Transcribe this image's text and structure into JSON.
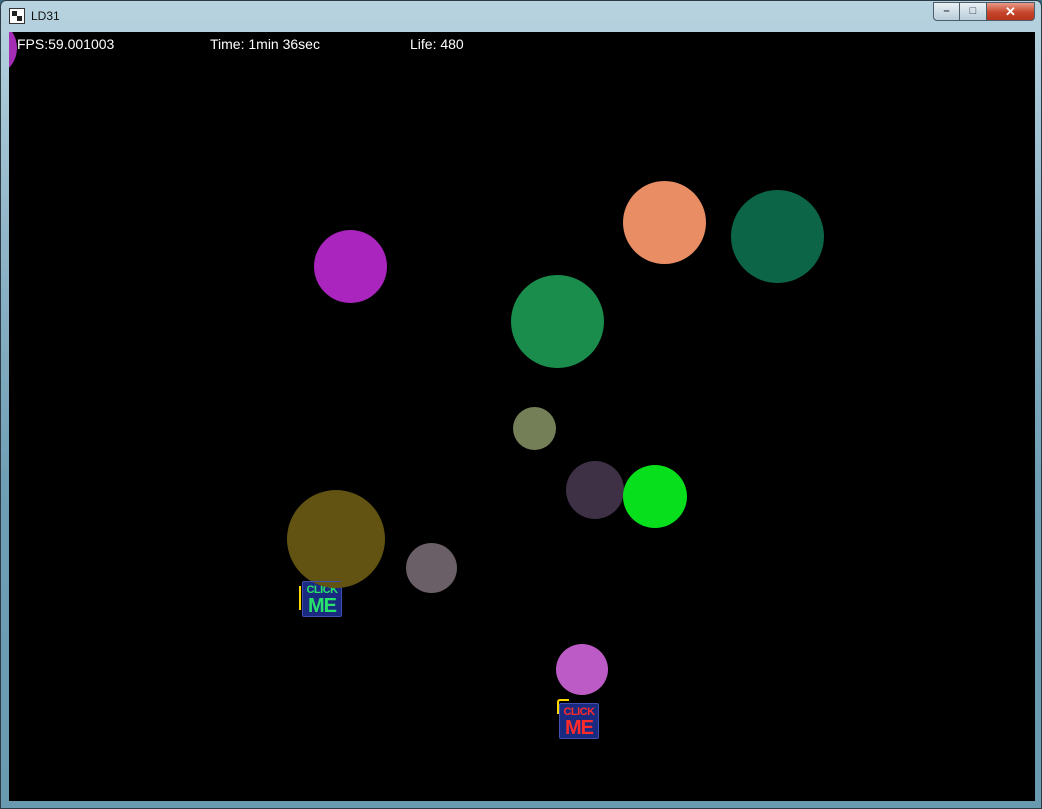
{
  "window": {
    "title": "LD31",
    "app_icon": "game-app-icon"
  },
  "controls": {
    "minimize": "–",
    "maximize": "□",
    "close": "✕"
  },
  "hud": {
    "fps": "FPS:59.001003",
    "time": "Time: 1min 36sec",
    "life": "Life: 480"
  },
  "balls": [
    {
      "name": "ball-magenta-edge",
      "color": "#a42db6"
    },
    {
      "name": "ball-purple",
      "color": "#a925bd"
    },
    {
      "name": "ball-salmon",
      "color": "#e98d64"
    },
    {
      "name": "ball-dark-green",
      "color": "#0c6547"
    },
    {
      "name": "ball-green",
      "color": "#1a8d4d"
    },
    {
      "name": "ball-olive-small",
      "color": "#747f57"
    },
    {
      "name": "ball-dark-purple",
      "color": "#3e3146"
    },
    {
      "name": "ball-bright-green",
      "color": "#07df1c"
    },
    {
      "name": "ball-olive-large",
      "color": "#625313"
    },
    {
      "name": "ball-grey-mauve",
      "color": "#6a5e67"
    },
    {
      "name": "ball-orchid",
      "color": "#bd5bc6"
    }
  ],
  "click_targets": [
    {
      "line1": "CLICK",
      "line2": "ME",
      "text_color": "#27e36a"
    },
    {
      "line1": "CLICK",
      "line2": "ME",
      "text_color": "#ff2a2a"
    }
  ]
}
